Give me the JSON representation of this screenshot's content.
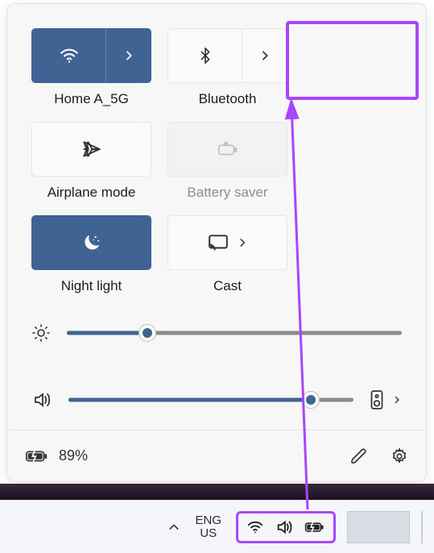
{
  "tiles": [
    {
      "label": "Home A_5G",
      "icon": "wifi-icon",
      "state": "on",
      "split": true
    },
    {
      "label": "Bluetooth",
      "icon": "bluetooth-icon",
      "state": "off",
      "split": true
    },
    {
      "label": "Airplane mode",
      "icon": "airplane-icon",
      "state": "off",
      "split": false,
      "highlighted": true
    },
    {
      "label": "Battery saver",
      "icon": "battery-saver-icon",
      "state": "disabled",
      "split": false,
      "muted": true
    },
    {
      "label": "Night light",
      "icon": "night-light-icon",
      "state": "on",
      "split": false
    },
    {
      "label": "Cast",
      "icon": "cast-icon",
      "state": "off",
      "split": true,
      "arrow_only": true
    }
  ],
  "sliders": {
    "brightness": {
      "percent": 24
    },
    "volume": {
      "percent": 85
    }
  },
  "footer": {
    "battery_text": "89%"
  },
  "taskbar": {
    "lang_top": "ENG",
    "lang_bottom": "US"
  },
  "colors": {
    "accent": "#3f6392",
    "highlight": "#a845ff"
  }
}
